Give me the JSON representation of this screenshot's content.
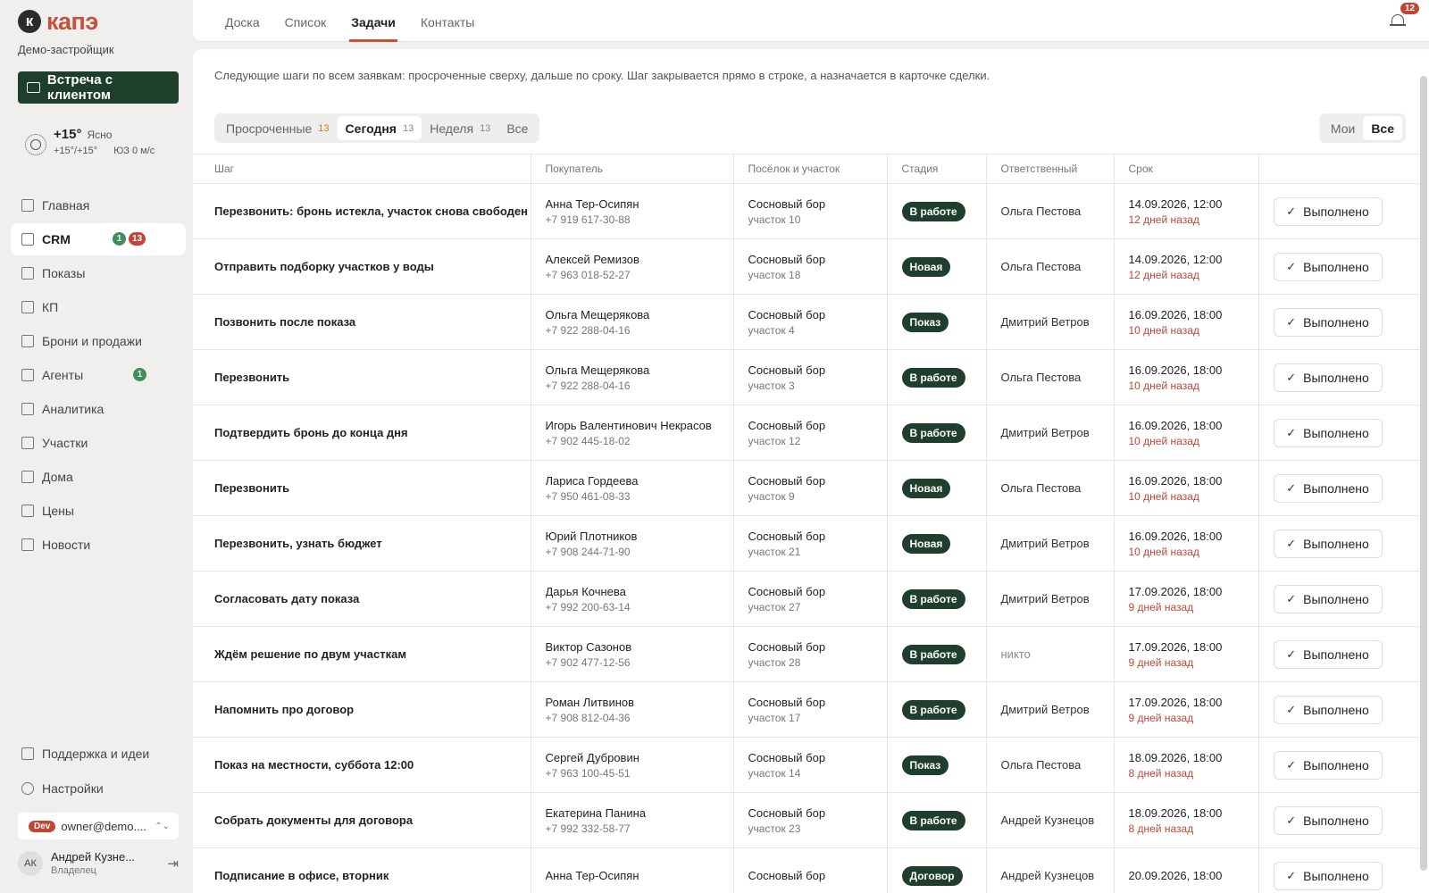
{
  "sidebar": {
    "logo_letter": "к",
    "logo_text": "капэ",
    "org": "Демо-застройщик",
    "meet_button": "Встреча с клиентом",
    "weather": {
      "temp": "+15°",
      "desc": "Ясно",
      "range": "+15°/+15°",
      "wind": "ЮЗ 0 м/с"
    },
    "nav": [
      {
        "label": "Главная",
        "icon": "grid-icon"
      },
      {
        "label": "CRM",
        "icon": "crm-icon",
        "badge_green": "1",
        "badge_red": "13",
        "active": true
      },
      {
        "label": "Показы",
        "icon": "monitor-icon"
      },
      {
        "label": "КП",
        "icon": "document-icon"
      },
      {
        "label": "Брони и продажи",
        "icon": "tag-icon"
      },
      {
        "label": "Агенты",
        "icon": "agents-icon",
        "badge_green": "1"
      },
      {
        "label": "Аналитика",
        "icon": "chart-icon"
      },
      {
        "label": "Участки",
        "icon": "plots-icon"
      },
      {
        "label": "Дома",
        "icon": "home-icon"
      },
      {
        "label": "Цены",
        "icon": "price-icon"
      },
      {
        "label": "Новости",
        "icon": "megaphone-icon"
      }
    ],
    "support": "Поддержка и идеи",
    "settings": "Настройки",
    "account": {
      "tag": "Dev",
      "email": "owner@demo...."
    },
    "user": {
      "initials": "АК",
      "name": "Андрей Кузне...",
      "role": "Владелец"
    }
  },
  "topbar": {
    "tabs": [
      "Доска",
      "Список",
      "Задачи",
      "Контакты"
    ],
    "active_tab": "Задачи",
    "notifications": "12"
  },
  "main": {
    "hint": "Следующие шаги по всем заявкам: просроченные сверху, дальше по сроку. Шаг закрывается прямо в строке, а назначается в карточке сделки.",
    "filters": [
      {
        "label": "Просроченные",
        "count": "13"
      },
      {
        "label": "Сегодня",
        "count": "13"
      },
      {
        "label": "Неделя",
        "count": "13"
      },
      {
        "label": "Все",
        "count": ""
      }
    ],
    "scope": [
      "Мои",
      "Все"
    ],
    "columns": [
      "Шаг",
      "Покупатель",
      "Посёлок и участок",
      "Стадия",
      "Ответственный",
      "Срок",
      ""
    ],
    "done_label": "Выполнено",
    "rows": [
      {
        "step": "Перезвонить: бронь истекла, участок снова свободен",
        "buyer": "Анна Тер-Осипян",
        "phone": "+7 919 617-30-88",
        "village": "Сосновый бор",
        "plot": "участок 10",
        "stage": "В работе",
        "resp": "Ольга Пестова",
        "due": "14.09.2026, 12:00",
        "ago": "12 дней назад"
      },
      {
        "step": "Отправить подборку участков у воды",
        "buyer": "Алексей Ремизов",
        "phone": "+7 963 018-52-27",
        "village": "Сосновый бор",
        "plot": "участок 18",
        "stage": "Новая",
        "resp": "Ольга Пестова",
        "due": "14.09.2026, 12:00",
        "ago": "12 дней назад"
      },
      {
        "step": "Позвонить после показа",
        "buyer": "Ольга Мещерякова",
        "phone": "+7 922 288-04-16",
        "village": "Сосновый бор",
        "plot": "участок 4",
        "stage": "Показ",
        "resp": "Дмитрий Ветров",
        "due": "16.09.2026, 18:00",
        "ago": "10 дней назад"
      },
      {
        "step": "Перезвонить",
        "buyer": "Ольга Мещерякова",
        "phone": "+7 922 288-04-16",
        "village": "Сосновый бор",
        "plot": "участок 3",
        "stage": "В работе",
        "resp": "Ольга Пестова",
        "due": "16.09.2026, 18:00",
        "ago": "10 дней назад"
      },
      {
        "step": "Подтвердить бронь до конца дня",
        "buyer": "Игорь Валентинович Некрасов",
        "phone": "+7 902 445-18-02",
        "village": "Сосновый бор",
        "plot": "участок 12",
        "stage": "В работе",
        "resp": "Дмитрий Ветров",
        "due": "16.09.2026, 18:00",
        "ago": "10 дней назад"
      },
      {
        "step": "Перезвонить",
        "buyer": "Лариса Гордеева",
        "phone": "+7 950 461-08-33",
        "village": "Сосновый бор",
        "plot": "участок 9",
        "stage": "Новая",
        "resp": "Ольга Пестова",
        "due": "16.09.2026, 18:00",
        "ago": "10 дней назад"
      },
      {
        "step": "Перезвонить, узнать бюджет",
        "buyer": "Юрий Плотников",
        "phone": "+7 908 244-71-90",
        "village": "Сосновый бор",
        "plot": "участок 21",
        "stage": "Новая",
        "resp": "Дмитрий Ветров",
        "due": "16.09.2026, 18:00",
        "ago": "10 дней назад"
      },
      {
        "step": "Согласовать дату показа",
        "buyer": "Дарья Кочнева",
        "phone": "+7 992 200-63-14",
        "village": "Сосновый бор",
        "plot": "участок 27",
        "stage": "В работе",
        "resp": "Дмитрий Ветров",
        "due": "17.09.2026, 18:00",
        "ago": "9 дней назад"
      },
      {
        "step": "Ждём решение по двум участкам",
        "buyer": "Виктор Сазонов",
        "phone": "+7 902 477-12-56",
        "village": "Сосновый бор",
        "plot": "участок 28",
        "stage": "В работе",
        "resp": "никто",
        "due": "17.09.2026, 18:00",
        "ago": "9 дней назад"
      },
      {
        "step": "Напомнить про договор",
        "buyer": "Роман Литвинов",
        "phone": "+7 908 812-04-36",
        "village": "Сосновый бор",
        "plot": "участок 17",
        "stage": "В работе",
        "resp": "Дмитрий Ветров",
        "due": "17.09.2026, 18:00",
        "ago": "9 дней назад"
      },
      {
        "step": "Показ на местности, суббота 12:00",
        "buyer": "Сергей Дубровин",
        "phone": "+7 963 100-45-51",
        "village": "Сосновый бор",
        "plot": "участок 14",
        "stage": "Показ",
        "resp": "Ольга Пестова",
        "due": "18.09.2026, 18:00",
        "ago": "8 дней назад"
      },
      {
        "step": "Собрать документы для договора",
        "buyer": "Екатерина Панина",
        "phone": "+7 992 332-58-77",
        "village": "Сосновый бор",
        "plot": "участок 23",
        "stage": "В работе",
        "resp": "Андрей Кузнецов",
        "due": "18.09.2026, 18:00",
        "ago": "8 дней назад"
      },
      {
        "step": "Подписание в офисе, вторник",
        "buyer": "Анна Тер-Осипян",
        "phone": "",
        "village": "Сосновый бор",
        "plot": "",
        "stage": "Договор",
        "resp": "Андрей Кузнецов",
        "due": "20.09.2026, 18:00",
        "ago": ""
      }
    ]
  },
  "colors": {
    "brand": "#c6523a",
    "dark_green": "#1d3f2c",
    "overdue": "#c14637",
    "badge_green": "#3f8f5a"
  }
}
